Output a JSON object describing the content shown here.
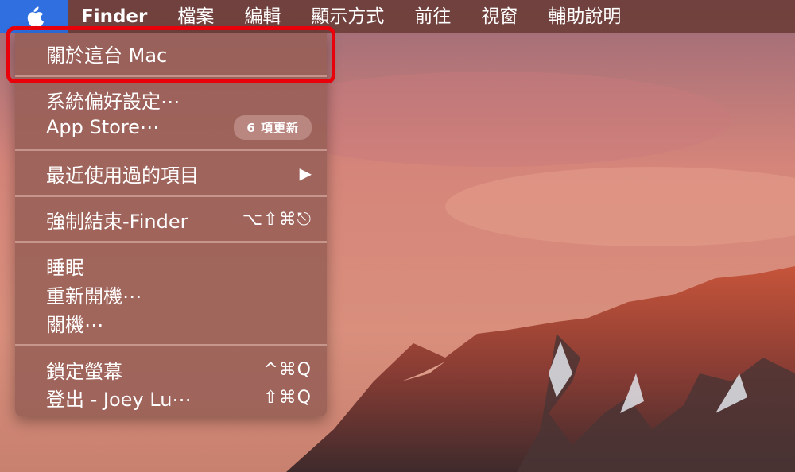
{
  "menubar": {
    "apple_icon": "apple-logo-icon",
    "items": [
      {
        "label": "Finder",
        "bold": true
      },
      {
        "label": "檔案"
      },
      {
        "label": "編輯"
      },
      {
        "label": "顯示方式"
      },
      {
        "label": "前往"
      },
      {
        "label": "視窗"
      },
      {
        "label": "輔助說明"
      }
    ]
  },
  "apple_menu": {
    "about": "關於這台 Mac",
    "system_prefs": "系統偏好設定⋯",
    "app_store": "App Store⋯",
    "app_store_badge": "6 項更新",
    "recent_items": "最近使用過的項目",
    "recent_items_arrow": "▶",
    "force_quit": "強制結束-Finder",
    "force_quit_shortcut": "⌥⇧⌘⎋",
    "sleep": "睡眠",
    "restart": "重新開機⋯",
    "shutdown": "關機⋯",
    "lock_screen": "鎖定螢幕",
    "lock_screen_shortcut": "^⌘Q",
    "logout": "登出 - Joey Lu⋯",
    "logout_shortcut": "⇧⌘Q"
  },
  "colors": {
    "highlight": "#e8000b",
    "apple_selected": "#2f6fe0"
  }
}
